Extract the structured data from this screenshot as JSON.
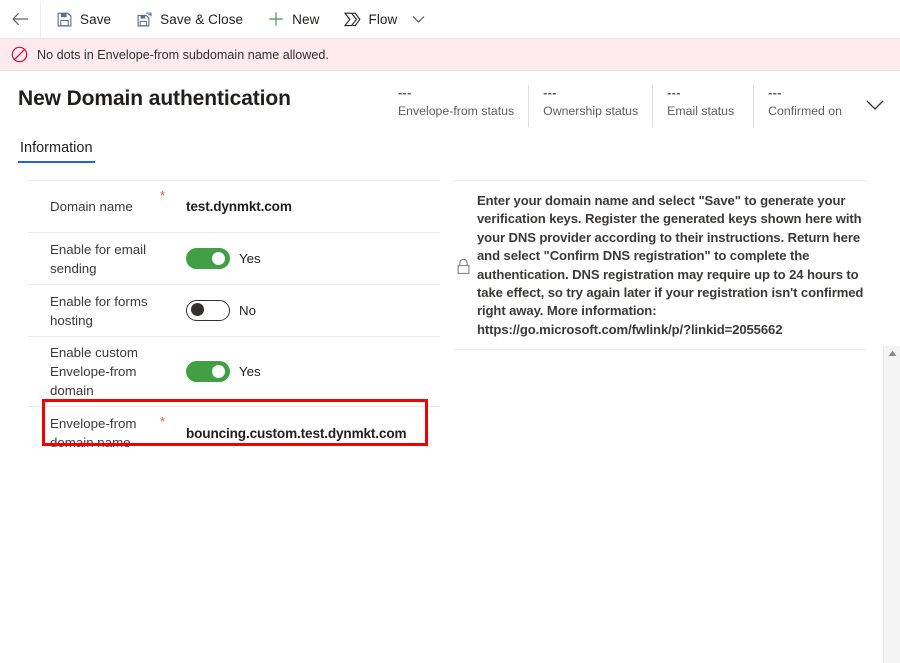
{
  "commandbar": {
    "back_label": "Back",
    "items": [
      {
        "label": "Save",
        "icon": "save-icon"
      },
      {
        "label": "Save & Close",
        "icon": "save-and-close-icon"
      },
      {
        "label": "New",
        "icon": "plus-icon"
      },
      {
        "label": "Flow",
        "icon": "flow-icon"
      }
    ],
    "overflow_label": "More commands"
  },
  "notification": {
    "icon": "error-blocked-icon",
    "message": "No dots in Envelope-from subdomain name allowed."
  },
  "header": {
    "title": "New Domain authentication",
    "statuses": [
      {
        "value": "---",
        "label": "Envelope-from status"
      },
      {
        "value": "---",
        "label": "Ownership status"
      },
      {
        "value": "---",
        "label": "Email status"
      },
      {
        "value": "---",
        "label": "Confirmed on"
      }
    ],
    "expand_icon": "chevron-down-icon"
  },
  "tabs": [
    {
      "label": "Information",
      "active": true
    }
  ],
  "form": {
    "required_marker": "*",
    "rows": [
      {
        "label": "Domain name",
        "required": true,
        "type": "text",
        "value": "test.dynmkt.com"
      },
      {
        "label": "Enable for email sending",
        "required": false,
        "type": "toggle",
        "state": "on",
        "value": "Yes"
      },
      {
        "label": "Enable for forms hosting",
        "required": false,
        "type": "toggle",
        "state": "off",
        "value": "No"
      },
      {
        "label": "Enable custom Envelope-from domain",
        "required": false,
        "type": "toggle",
        "state": "on",
        "value": "Yes"
      },
      {
        "label": "Envelope-from domain name",
        "required": true,
        "type": "text",
        "value": "bouncing.custom.test.dynmkt.com",
        "highlighted": true
      }
    ]
  },
  "info_panel": {
    "icon": "lock-icon",
    "text": "Enter your domain name and select \"Save\" to generate your verification keys. Register the generated keys shown here with your DNS provider according to their instructions. Return here and select \"Confirm DNS registration\" to complete the authentication. DNS registration may require up to 24 hours to take effect, so try again later if your registration isn't confirmed right away. More information: https://go.microsoft.com/fwlink/p/?linkid=2055662"
  },
  "scrollbar": {
    "up_arrow_icon": "scroll-up-arrow-icon"
  },
  "colors": {
    "accent": "#2266d3",
    "toggle_on": "#41a046",
    "error_banner_bg": "#fdeaee",
    "error_outline": "#ee0000",
    "required_star": "#e8533f",
    "new_icon_green": "#5aa55f"
  }
}
